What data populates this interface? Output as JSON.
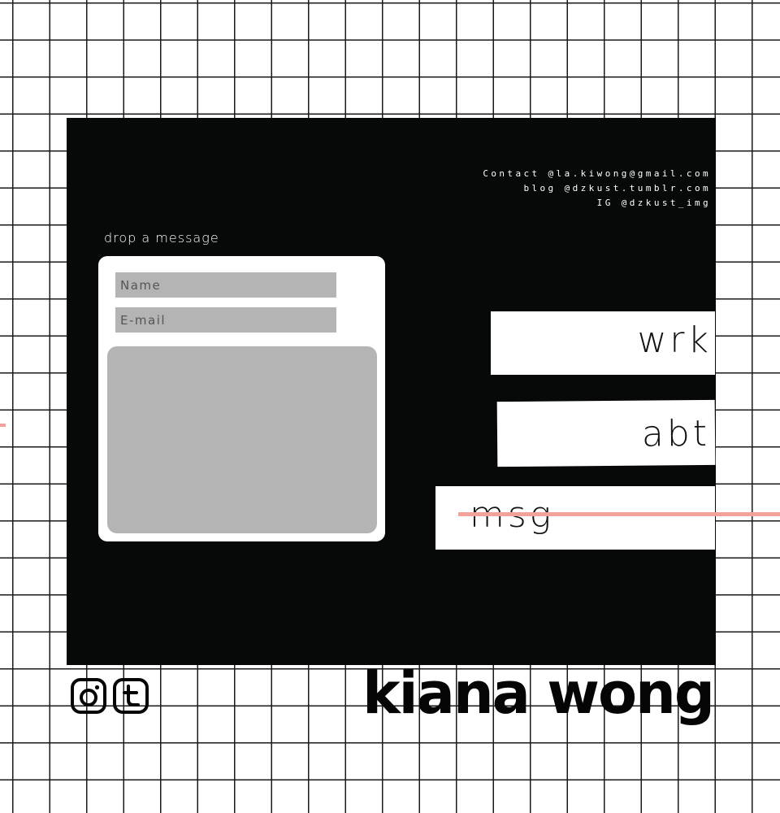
{
  "contact": {
    "line1": "Contact @la.kiwong@gmail.com",
    "line2": "blog @dzkust.tumblr.com",
    "line3": "IG @dzkust_img"
  },
  "form": {
    "heading": "drop a message",
    "name_placeholder": "Name",
    "email_placeholder": "E-mail"
  },
  "nav": {
    "wrk": "wrk",
    "abt": "abt",
    "msg": "msg"
  },
  "footer": {
    "brand": "kiana wong",
    "social": [
      "instagram-icon",
      "tumblr-icon"
    ]
  },
  "colors": {
    "panel": "#070909",
    "accent": "#f3a29a",
    "field": "#b4b4b4"
  }
}
